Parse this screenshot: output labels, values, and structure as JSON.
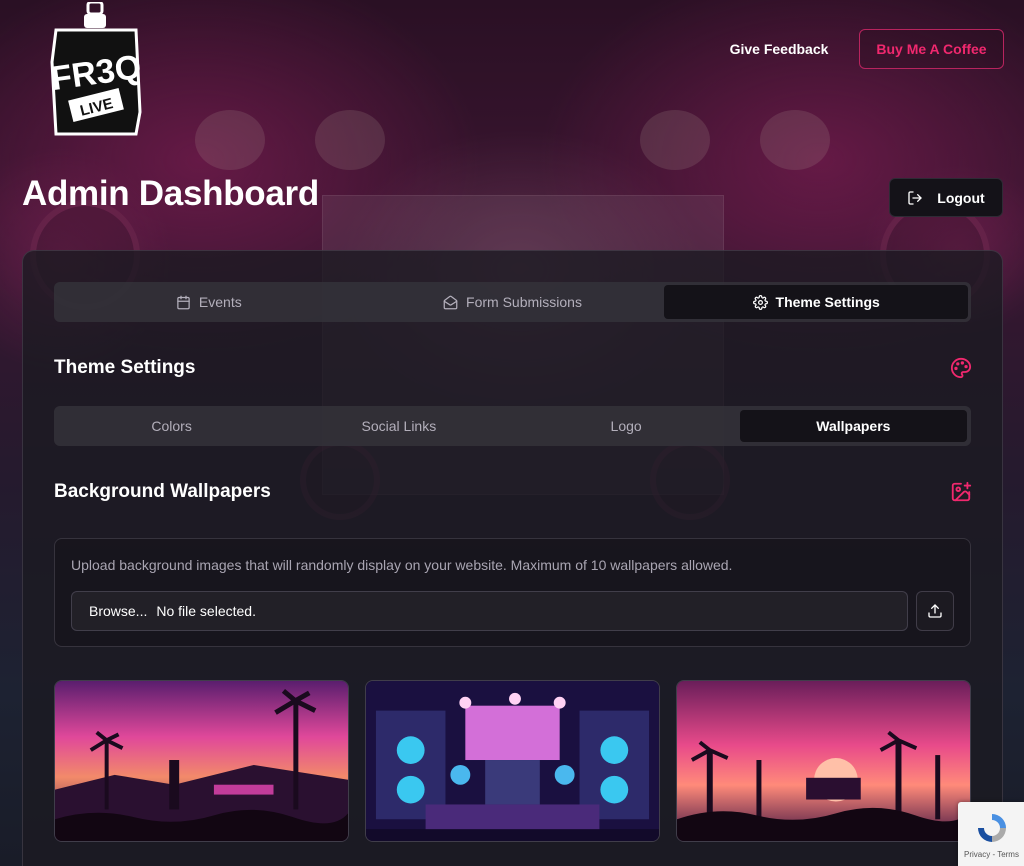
{
  "header": {
    "logo_text": "FR3Q LIVE",
    "give_feedback_label": "Give Feedback",
    "buy_coffee_label": "Buy Me A Coffee"
  },
  "page_title": "Admin Dashboard",
  "logout_label": "Logout",
  "main_tabs": [
    {
      "label": "Events",
      "icon": "calendar-icon",
      "active": false
    },
    {
      "label": "Form Submissions",
      "icon": "envelope-open-icon",
      "active": false
    },
    {
      "label": "Theme Settings",
      "icon": "gear-icon",
      "active": true
    }
  ],
  "theme_settings": {
    "title": "Theme Settings",
    "icon": "palette-icon",
    "subtabs": [
      {
        "label": "Colors",
        "active": false
      },
      {
        "label": "Social Links",
        "active": false
      },
      {
        "label": "Logo",
        "active": false
      },
      {
        "label": "Wallpapers",
        "active": true
      }
    ]
  },
  "wallpapers": {
    "title": "Background Wallpapers",
    "icon": "image-plus-icon",
    "description": "Upload background images that will randomly display on your website. Maximum of 10 wallpapers allowed.",
    "browse_label": "Browse...",
    "file_status": "No file selected.",
    "upload_icon": "upload-icon",
    "items": [
      {
        "thumbnail": "festival-sunset-palms"
      },
      {
        "thumbnail": "stage-speakers-neon"
      },
      {
        "thumbnail": "palm-sunset-stage"
      }
    ]
  },
  "recaptcha": {
    "text": "Privacy - Terms"
  },
  "colors": {
    "accent": "#f0286e",
    "background": "#1d1a24",
    "active_tab": "#141218"
  }
}
